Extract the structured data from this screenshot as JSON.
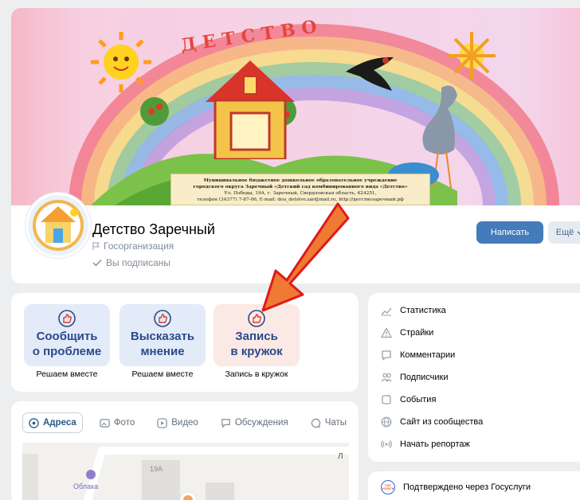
{
  "profile": {
    "cover_header_letters": "ДЕТСТВО",
    "cover_org_text_1": "Муниципальное бюджетное дошкольное образовательное учреждение",
    "cover_org_text_2": "городского округа Заречный «Детский сад комбинированного вида «Детство»",
    "cover_org_text_3": "Ул. Победы, 19А, г. Заречный, Свердловская область, 624251,",
    "cover_org_text_4": "телефон (34377) 7-87-06, E-mail: dou_detstvo.zar@mail.ru, http://детствозаречный.рф",
    "title": "Детство Заречный",
    "type": "Госорганизация",
    "subscribed": "Вы подписаны",
    "write_button": "Написать",
    "more_button": "Ещё"
  },
  "services": [
    {
      "title_1": "Сообщить",
      "title_2": "о проблеме",
      "caption": "Решаем вместе",
      "bg": "#e3ebf8"
    },
    {
      "title_1": "Высказать",
      "title_2": "мнение",
      "caption": "Решаем вместе",
      "bg": "#e3ebf8"
    },
    {
      "title_1": "Запись",
      "title_2": "в кружок",
      "caption": "Запись в кружок",
      "bg": "#fbe9e5"
    }
  ],
  "tabs": [
    {
      "label": "Адреса",
      "active": true
    },
    {
      "label": "Фото",
      "active": false
    },
    {
      "label": "Видео",
      "active": false
    },
    {
      "label": "Обсуждения",
      "active": false
    },
    {
      "label": "Чаты",
      "active": false
    }
  ],
  "map": {
    "building_label": "19А",
    "place_label": "Облака",
    "road_letter": "Л"
  },
  "menu": [
    {
      "label": "Статистика",
      "icon": "chart-icon"
    },
    {
      "label": "Страйки",
      "icon": "warning-icon"
    },
    {
      "label": "Комментарии",
      "icon": "comment-icon"
    },
    {
      "label": "Подписчики",
      "icon": "users-icon"
    },
    {
      "label": "События",
      "icon": "event-icon"
    },
    {
      "label": "Сайт из сообщества",
      "icon": "globe-icon"
    },
    {
      "label": "Начать репортаж",
      "icon": "broadcast-icon"
    }
  ],
  "gosuslugi": {
    "label": "Подтверждено через Госуслуги",
    "badge_text": "ГОС УСЛУГИ"
  },
  "colors": {
    "accent": "#447bba",
    "secondary_button": "#e5ebf1",
    "arrow_fill": "#ee7a33",
    "arrow_stroke": "#e01a1a"
  }
}
